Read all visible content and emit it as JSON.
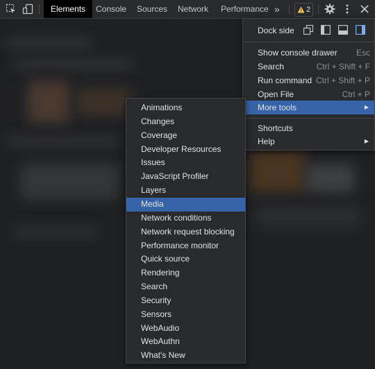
{
  "toolbar": {
    "icons": [
      "inspect-element-icon",
      "device-toolbar-icon",
      "more-tabs-icon",
      "warning-icon",
      "gear-icon",
      "kebab-menu-icon",
      "close-icon"
    ],
    "tabs": [
      {
        "label": "Elements",
        "active": true
      },
      {
        "label": "Console",
        "active": false
      },
      {
        "label": "Sources",
        "active": false
      },
      {
        "label": "Network",
        "active": false
      },
      {
        "label": "Performance",
        "active": false
      }
    ],
    "more_tabs_label": "»",
    "warning_count": "2"
  },
  "main_menu": {
    "dock_side_label": "Dock side",
    "dock_options": [
      "undock-icon",
      "dock-left-icon",
      "dock-bottom-icon",
      "dock-right-icon"
    ],
    "dock_selected": "dock-right-icon",
    "items": [
      {
        "label": "Show console drawer",
        "shortcut": "Esc"
      },
      {
        "label": "Search",
        "shortcut": "Ctrl + Shift + F"
      },
      {
        "label": "Run command",
        "shortcut": "Ctrl + Shift + P"
      },
      {
        "label": "Open File",
        "shortcut": "Ctrl + P"
      },
      {
        "label": "More tools",
        "shortcut": "",
        "highlighted": true,
        "has_submenu": true
      },
      {
        "label": "Shortcuts",
        "shortcut": ""
      },
      {
        "label": "Help",
        "shortcut": "",
        "has_submenu": true
      }
    ]
  },
  "more_tools_menu": {
    "items": [
      "Animations",
      "Changes",
      "Coverage",
      "Developer Resources",
      "Issues",
      "JavaScript Profiler",
      "Layers",
      "Media",
      "Network conditions",
      "Network request blocking",
      "Performance monitor",
      "Quick source",
      "Rendering",
      "Search",
      "Security",
      "Sensors",
      "WebAudio",
      "WebAuthn",
      "What's New"
    ],
    "highlighted": "Media"
  },
  "colors": {
    "background": "#1f2024",
    "menu_background": "#292a2d",
    "highlight": "#3763a8",
    "active_tab": "#000000",
    "warning": "#f2c94c",
    "dock_selected": "#7cacf8"
  }
}
